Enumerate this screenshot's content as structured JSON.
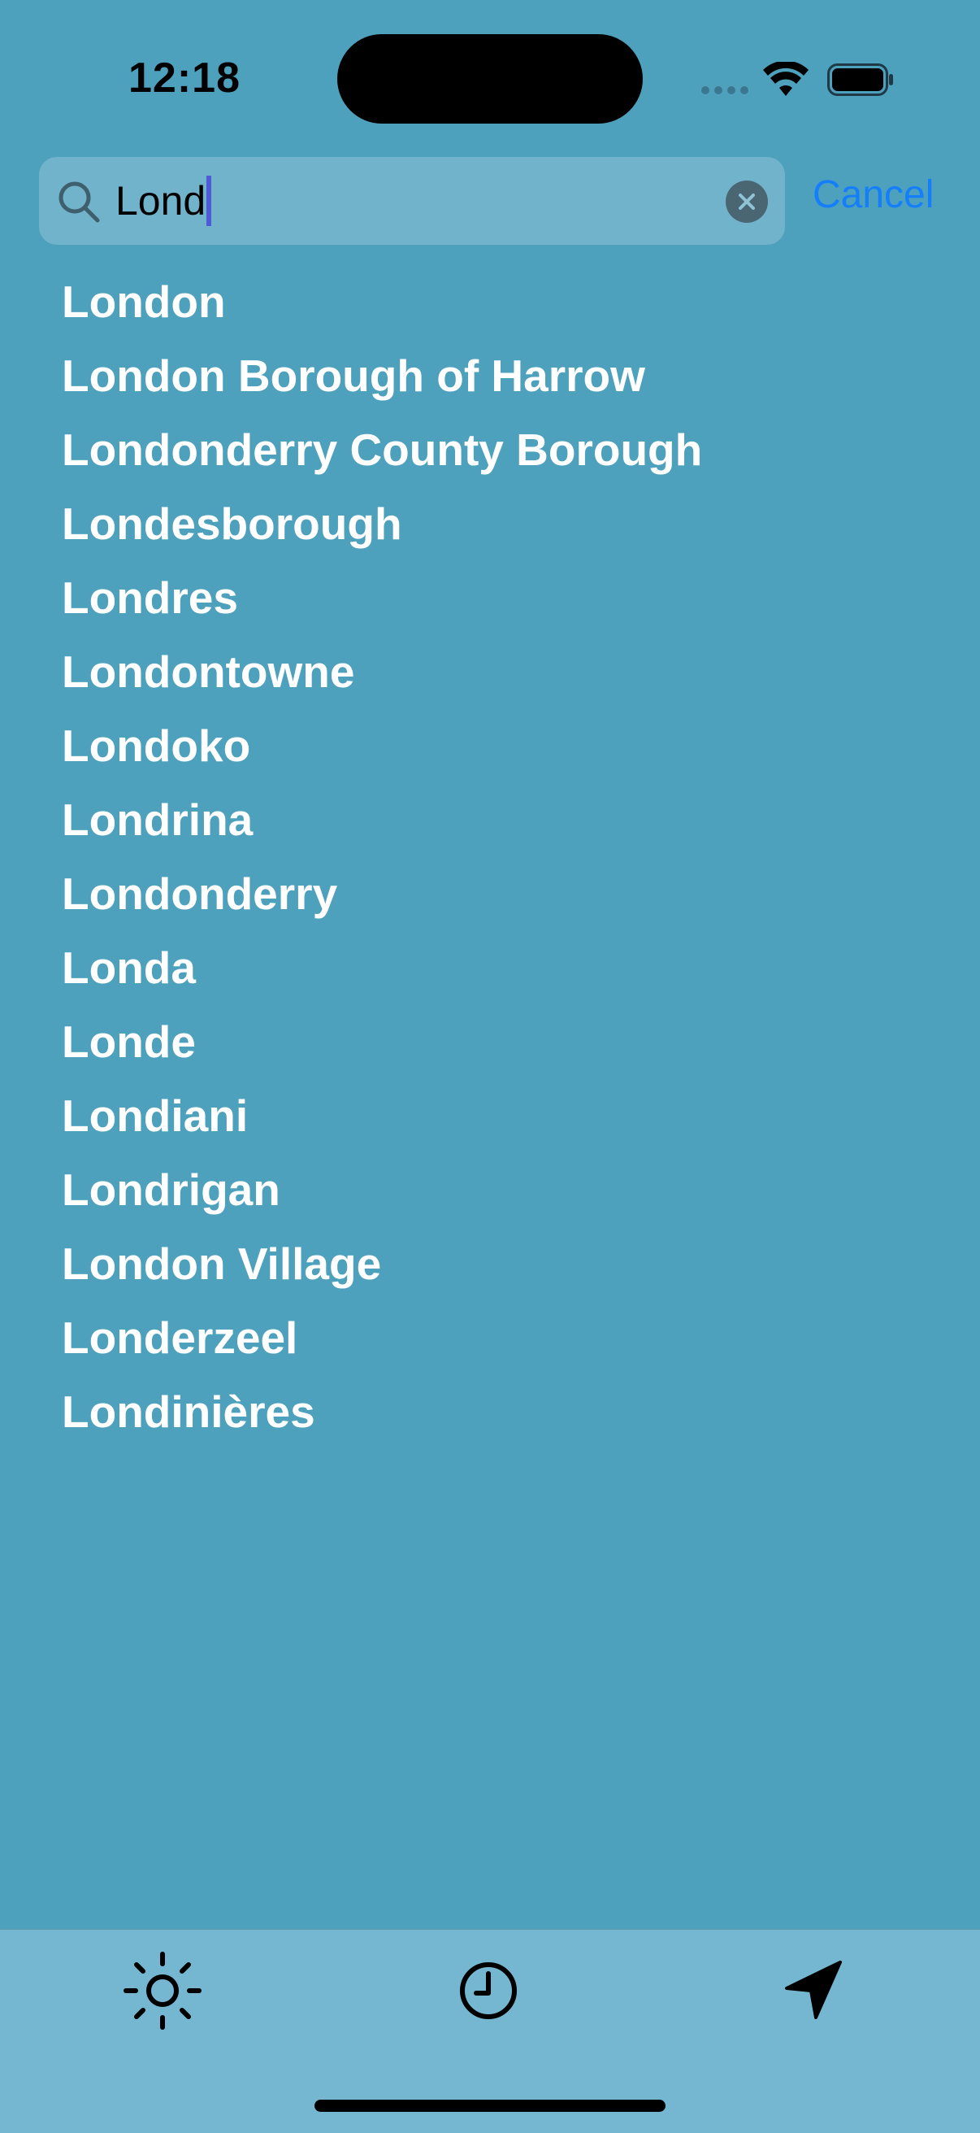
{
  "status_bar": {
    "time": "12:18",
    "signal_icon": "cellular-dots-icon",
    "wifi_icon": "wifi-icon",
    "battery_icon": "battery-icon"
  },
  "search": {
    "value": "Lond",
    "icon": "search-icon",
    "clear_icon": "clear-icon",
    "cancel_label": "Cancel"
  },
  "results": [
    "London",
    "London Borough of Harrow",
    "Londonderry County Borough",
    "Londesborough",
    "Londres",
    "Londontowne",
    "Londoko",
    "Londrina",
    "Londonderry",
    "Londa",
    "Londe",
    "Londiani",
    "Londrigan",
    "London Village",
    "Londerzeel",
    "Londinières"
  ],
  "tab_bar": {
    "tabs": [
      {
        "icon": "sun-icon"
      },
      {
        "icon": "clock-icon"
      },
      {
        "icon": "location-arrow-icon"
      }
    ]
  },
  "colors": {
    "background": "#4da1bd",
    "tab_bar": "#75b7d0",
    "accent": "#157efb",
    "result_text": "#ffffff"
  }
}
